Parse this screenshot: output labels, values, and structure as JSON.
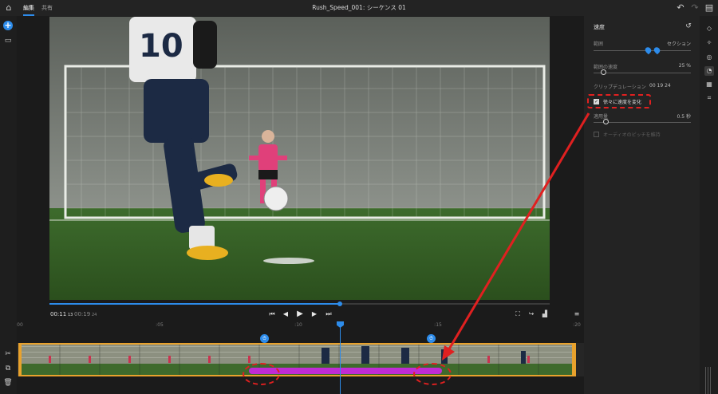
{
  "window": {
    "title": "Rush_Speed_001: シーケンス 01"
  },
  "tabs": [
    {
      "label": "編集"
    },
    {
      "label": "共有"
    }
  ],
  "transport": {
    "current_time": "00:11",
    "current_frames": "13",
    "duration": "00:19",
    "duration_frames": "24",
    "playback_progress": 0.58
  },
  "timeline": {
    "ruler_labels": [
      "00",
      ":05",
      ":10",
      ":15",
      ":20"
    ],
    "keyframe_icon": "speed-keyframe-icon"
  },
  "speed_panel": {
    "title": "速度",
    "range_label": "範囲",
    "range_value": "セクション",
    "range_speed_label": "範囲の速度",
    "range_speed_value": "25 %",
    "range_speed_level": 0.1,
    "clip_duration_label": "クリップデュレーション",
    "clip_duration_value": "00 19 24",
    "ramp_label": "徐々に速度を変化",
    "ramp_checked": true,
    "ramp_amount_label": "適用量",
    "ramp_amount_value": "0.5 秒",
    "ramp_amount_level": 0.12,
    "keep_pitch_label": "オーディオのピッチを維持",
    "keep_pitch_checked": false
  },
  "colors": {
    "accent": "#2d8ceb",
    "clip_border": "#e8a22d",
    "speed_band": "#c02bd4",
    "annotation": "#e02020"
  }
}
